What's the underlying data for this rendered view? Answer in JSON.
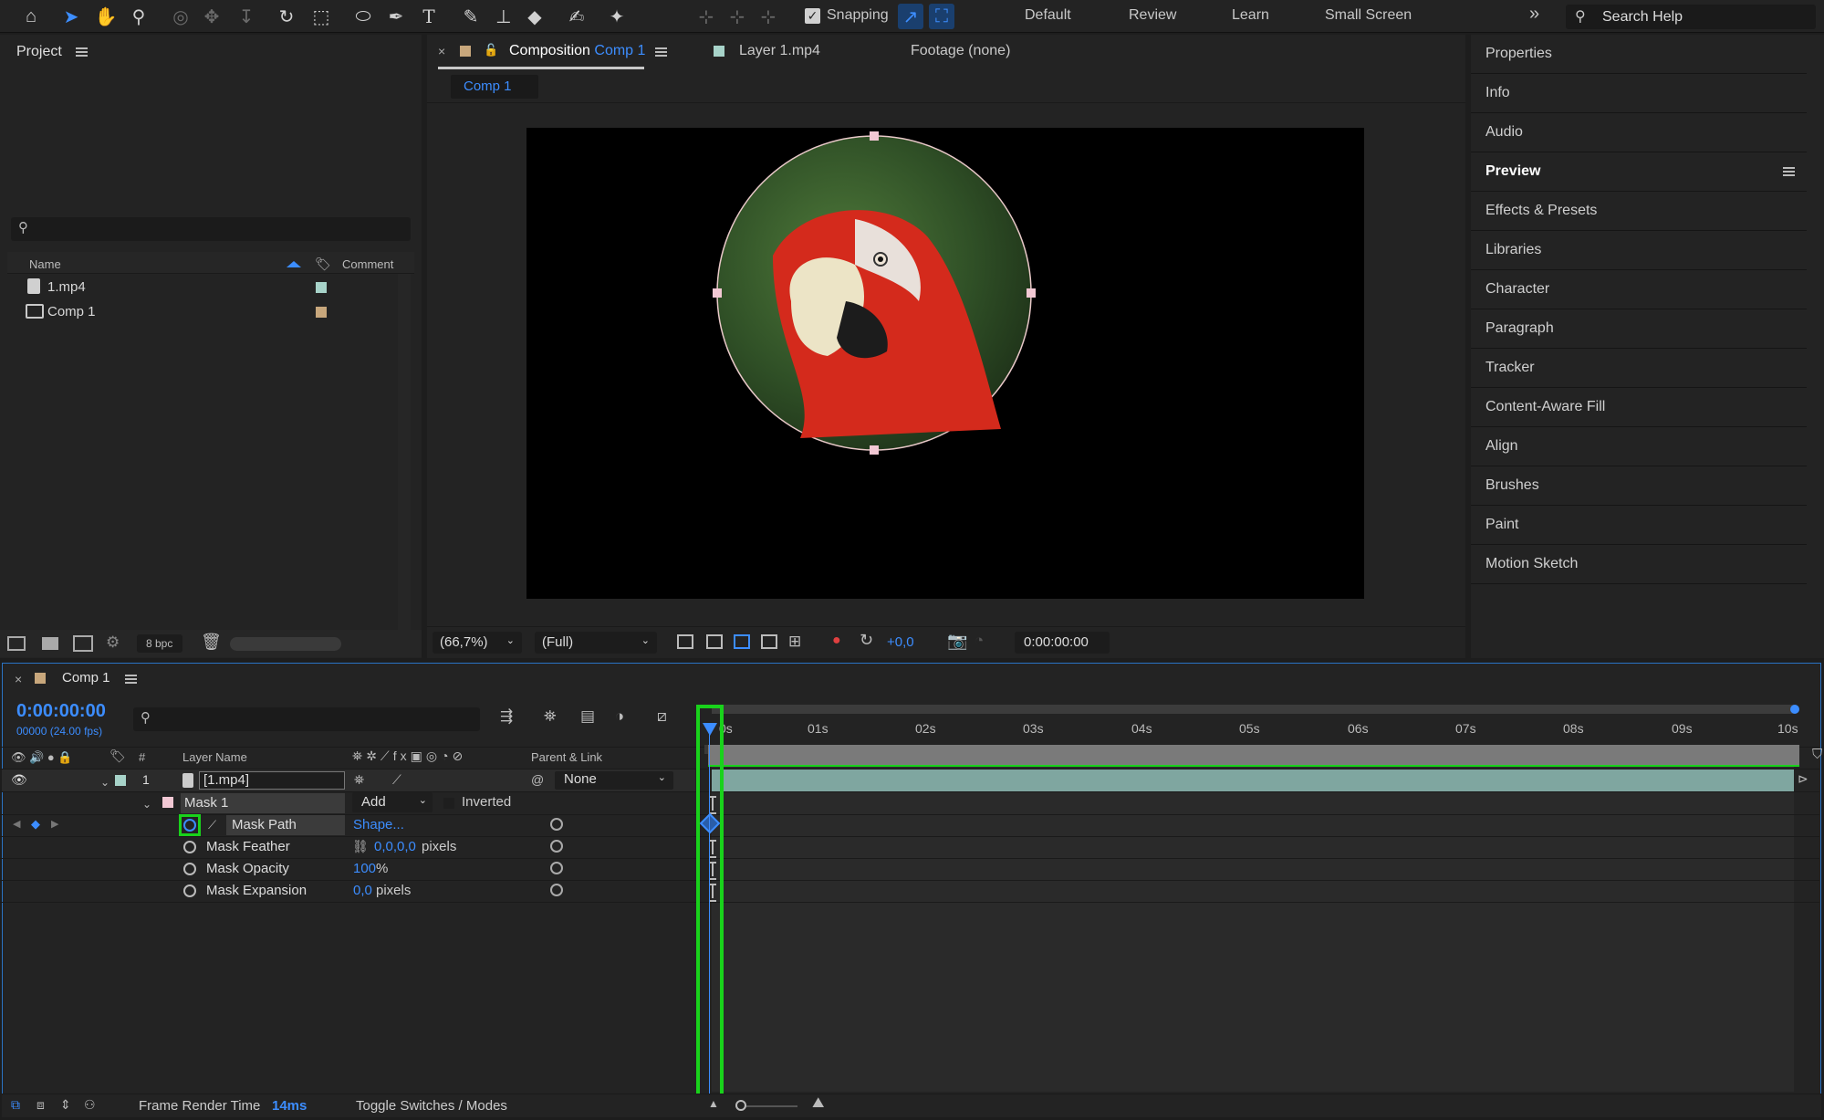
{
  "toolbar": {
    "snapping_label": "Snapping",
    "workspaces": [
      "Default",
      "Review",
      "Learn",
      "Small Screen"
    ],
    "overflow": "»",
    "search_placeholder": "Search Help"
  },
  "project": {
    "title": "Project",
    "columns": {
      "name": "Name",
      "comment": "Comment"
    },
    "items": [
      {
        "name": "1.mp4",
        "label_color": "#a7d3c9"
      },
      {
        "name": "Comp 1",
        "label_color": "#c8a77c"
      }
    ],
    "bpc": "8 bpc"
  },
  "viewer": {
    "tab_composition_prefix": "Composition",
    "tab_composition_name": "Comp 1",
    "tab_layer": "Layer 1.mp4",
    "tab_footage": "Footage (none)",
    "subtab": "Comp 1",
    "zoom": "(66,7%)",
    "resolution": "(Full)",
    "exposure": "+0,0",
    "timecode": "0:00:00:00"
  },
  "right_panels": [
    "Properties",
    "Info",
    "Audio",
    "Preview",
    "Effects & Presets",
    "Libraries",
    "Character",
    "Paragraph",
    "Tracker",
    "Content-Aware Fill",
    "Align",
    "Brushes",
    "Paint",
    "Motion Sketch"
  ],
  "timeline": {
    "comp_name": "Comp 1",
    "current_time": "0:00:00:00",
    "frame_info": "00000 (24.00 fps)",
    "col_num": "#",
    "col_layer_name": "Layer Name",
    "col_parent": "Parent & Link",
    "ruler": [
      "0s",
      "01s",
      "02s",
      "03s",
      "04s",
      "05s",
      "06s",
      "07s",
      "08s",
      "09s",
      "10s"
    ],
    "layer": {
      "index": "1",
      "name": "[1.mp4]",
      "parent": "None"
    },
    "mask": {
      "name": "Mask 1",
      "mode": "Add",
      "inverted": "Inverted"
    },
    "props": [
      {
        "name": "Mask Path",
        "value": "Shape...",
        "unit": ""
      },
      {
        "name": "Mask Feather",
        "value": "0,0,0,0",
        "unit": "pixels"
      },
      {
        "name": "Mask Opacity",
        "value": "100",
        "unit": "%"
      },
      {
        "name": "Mask Expansion",
        "value": "0,0",
        "unit": "pixels"
      }
    ],
    "frame_render_label": "Frame Render Time",
    "frame_render_value": "14ms",
    "toggle_label": "Toggle Switches / Modes"
  },
  "colors": {
    "accent": "#3c8dff",
    "highlight": "#19d21b",
    "layer_bar": "#7fa6a0"
  }
}
